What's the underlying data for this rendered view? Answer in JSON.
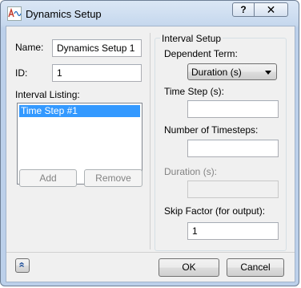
{
  "window": {
    "title": "Dynamics Setup",
    "help_glyph": "?",
    "close_glyph": "✕"
  },
  "left": {
    "name_label": "Name:",
    "name_value": "Dynamics Setup 1",
    "id_label": "ID:",
    "id_value": "1",
    "listing_label": "Interval Listing:",
    "listing_items": [
      "Time Step #1"
    ],
    "add_label": "Add",
    "remove_label": "Remove"
  },
  "interval_setup": {
    "group_title": "Interval Setup",
    "dependent_term_label": "Dependent Term:",
    "dependent_term_value": "Duration (s)",
    "time_step_label": "Time Step (s):",
    "time_step_value": "",
    "num_timesteps_label": "Number of Timesteps:",
    "num_timesteps_value": "",
    "duration_label": "Duration (s):",
    "duration_value": "",
    "skip_factor_label": "Skip Factor (for output):",
    "skip_factor_value": "1"
  },
  "footer": {
    "expand_glyph": "«",
    "ok_label": "OK",
    "cancel_label": "Cancel"
  },
  "colors": {
    "selection": "#3399ff",
    "title_bar": "#c6d8ee"
  }
}
